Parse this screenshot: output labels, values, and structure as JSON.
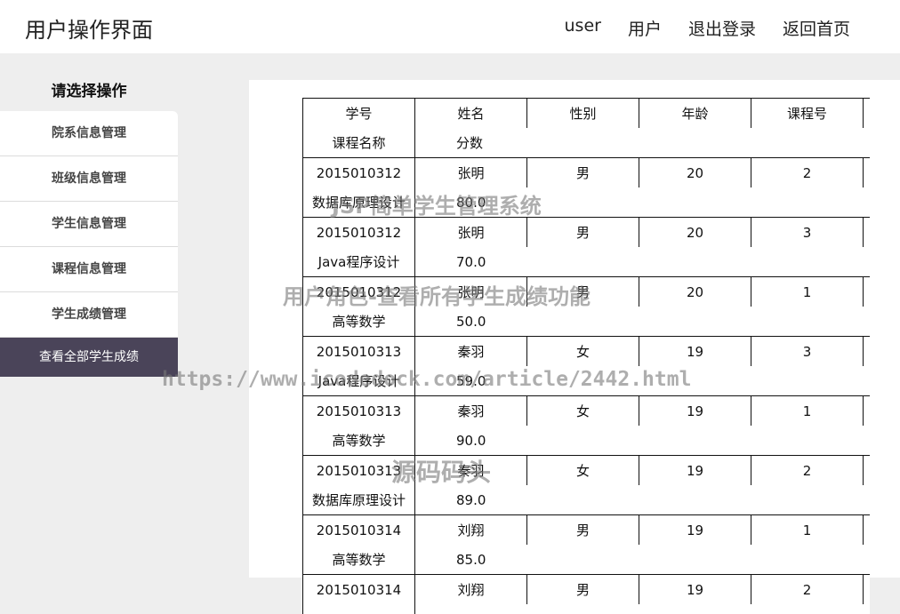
{
  "header": {
    "title": "用户操作界面",
    "nav": [
      "user",
      "用户",
      "退出登录",
      "返回首页"
    ]
  },
  "sidebar": {
    "title": "请选择操作",
    "items": [
      {
        "label": "院系信息管理",
        "active": false
      },
      {
        "label": "班级信息管理",
        "active": false
      },
      {
        "label": "学生信息管理",
        "active": false
      },
      {
        "label": "课程信息管理",
        "active": false
      },
      {
        "label": "学生成绩管理",
        "active": false
      },
      {
        "label": "查看全部学生成绩",
        "active": true
      }
    ]
  },
  "table": {
    "headers": [
      "学号",
      "姓名",
      "性别",
      "年龄",
      "课程号",
      "课程名称",
      "分数"
    ],
    "rows": [
      {
        "id": "2015010312",
        "name": "张明",
        "gender": "男",
        "age": "20",
        "course_no": "2",
        "course_name": "数据库原理设计",
        "score": "80.0"
      },
      {
        "id": "2015010312",
        "name": "张明",
        "gender": "男",
        "age": "20",
        "course_no": "3",
        "course_name": "Java程序设计",
        "score": "70.0"
      },
      {
        "id": "2015010312",
        "name": "张明",
        "gender": "男",
        "age": "20",
        "course_no": "1",
        "course_name": "高等数学",
        "score": "50.0"
      },
      {
        "id": "2015010313",
        "name": "秦羽",
        "gender": "女",
        "age": "19",
        "course_no": "3",
        "course_name": "Java程序设计",
        "score": "59.0"
      },
      {
        "id": "2015010313",
        "name": "秦羽",
        "gender": "女",
        "age": "19",
        "course_no": "1",
        "course_name": "高等数学",
        "score": "90.0"
      },
      {
        "id": "2015010313",
        "name": "秦羽",
        "gender": "女",
        "age": "19",
        "course_no": "2",
        "course_name": "数据库原理设计",
        "score": "89.0"
      },
      {
        "id": "2015010314",
        "name": "刘翔",
        "gender": "男",
        "age": "19",
        "course_no": "1",
        "course_name": "高等数学",
        "score": "85.0"
      },
      {
        "id": "2015010314",
        "name": "刘翔",
        "gender": "男",
        "age": "19",
        "course_no": "2",
        "course_name": "",
        "score": ""
      }
    ]
  },
  "watermarks": [
    "JSP简单学生管理系统",
    "用户角色-查看所有学生成绩功能",
    "https://www.icodedock.com/article/2442.html",
    "源码码头"
  ]
}
